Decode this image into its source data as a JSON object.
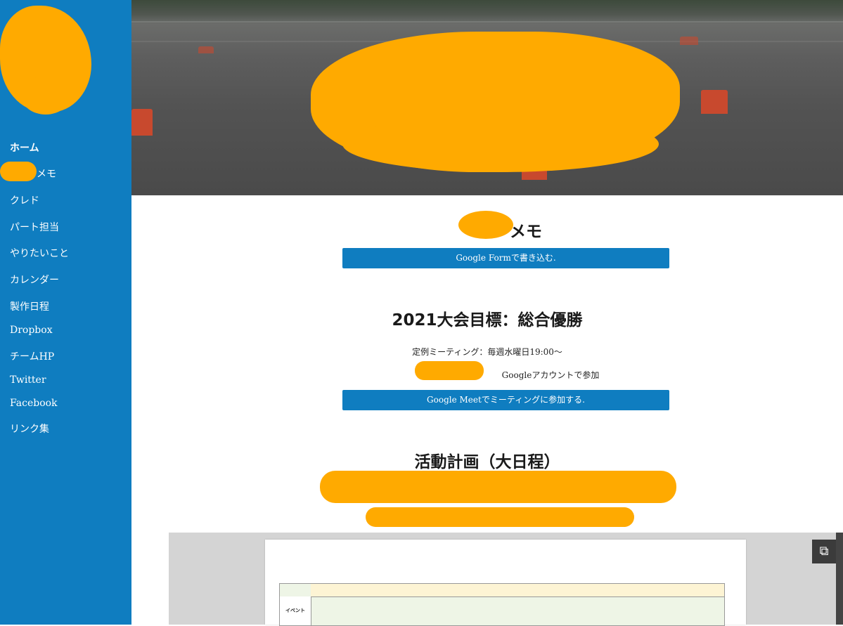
{
  "sidebar": {
    "items": [
      {
        "label": "ホーム"
      },
      {
        "label": "メモ"
      },
      {
        "label": "クレド"
      },
      {
        "label": "パート担当"
      },
      {
        "label": "やりたいこと"
      },
      {
        "label": "カレンダー"
      },
      {
        "label": "製作日程"
      },
      {
        "label": "Dropbox"
      },
      {
        "label": "チームHP"
      },
      {
        "label": "Twitter"
      },
      {
        "label": "Facebook"
      },
      {
        "label": "リンク集"
      }
    ]
  },
  "main": {
    "memo_heading": "メモ",
    "form_button": "Google Formで書き込む.",
    "goal_heading": "2021大会目標：総合優勝",
    "meeting_text": "定例ミーティング：毎週水曜日19:00〜",
    "account_text": "Googleアカウントで参加",
    "meet_button": "Google Meetでミーティングに参加する.",
    "plan_heading": "活動計画（大日程）",
    "sheet_event_label": "イベント"
  },
  "colors": {
    "sidebar": "#0f7dc0",
    "button": "#0f7dc0",
    "redaction": "#ffaa00"
  }
}
